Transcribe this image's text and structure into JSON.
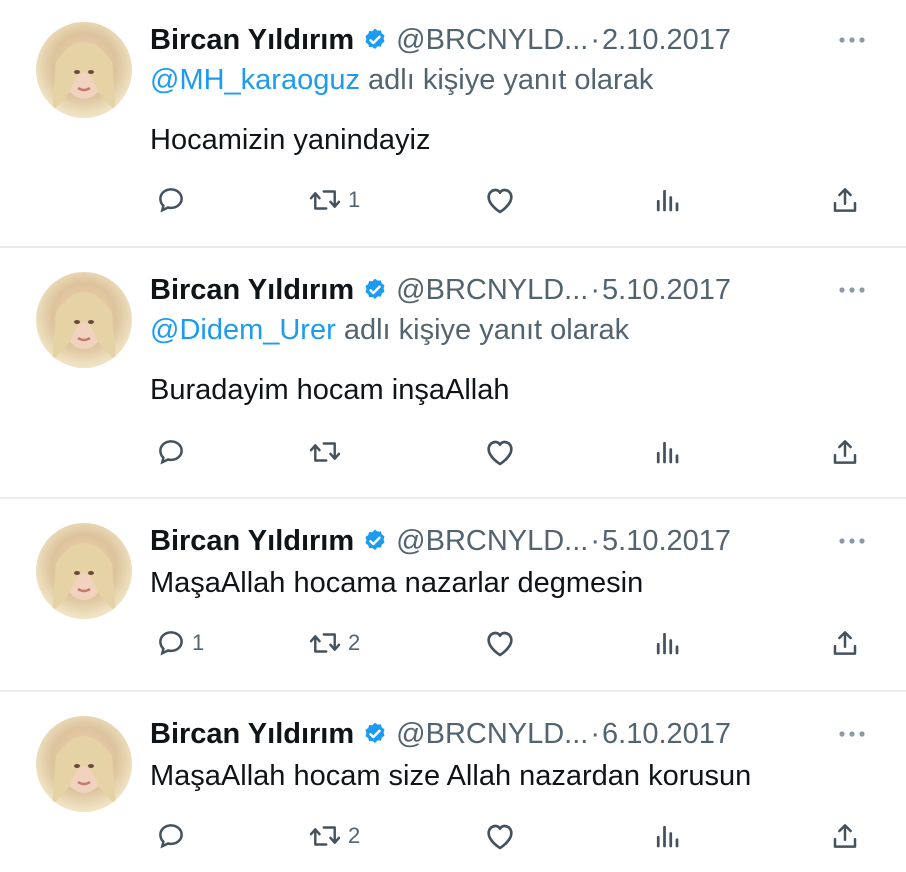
{
  "tweets": [
    {
      "author": "Bircan Yıldırım",
      "handle": "@BRCNYLD...",
      "separator": "·",
      "date": "2.10.2017",
      "reply_to": "@MH_karaoguz",
      "reply_suffix": " adlı kişiye yanıt olarak",
      "text": "Hocamizin yanindayiz",
      "replies": "",
      "retweets": "1"
    },
    {
      "author": "Bircan Yıldırım",
      "handle": "@BRCNYLD...",
      "separator": "·",
      "date": "5.10.2017",
      "reply_to": "@Didem_Urer",
      "reply_suffix": " adlı kişiye yanıt olarak",
      "text": "Buradayim hocam inşaAllah",
      "replies": "",
      "retweets": ""
    },
    {
      "author": "Bircan Yıldırım",
      "handle": "@BRCNYLD...",
      "separator": "·",
      "date": "5.10.2017",
      "text": "MaşaAllah hocama nazarlar degmesin",
      "replies": "1",
      "retweets": "2"
    },
    {
      "author": "Bircan Yıldırım",
      "handle": "@BRCNYLD...",
      "separator": "·",
      "date": "6.10.2017",
      "text": "MaşaAllah hocam size Allah nazardan korusun",
      "replies": "",
      "retweets": "2"
    }
  ],
  "colors": {
    "link": "#1d9bf0",
    "secondary_text": "#536471",
    "verified_badge": "#1d9bf0"
  },
  "icons": [
    "verified-badge-icon",
    "more-icon",
    "reply-icon",
    "retweet-icon",
    "like-icon",
    "views-icon",
    "share-icon"
  ]
}
